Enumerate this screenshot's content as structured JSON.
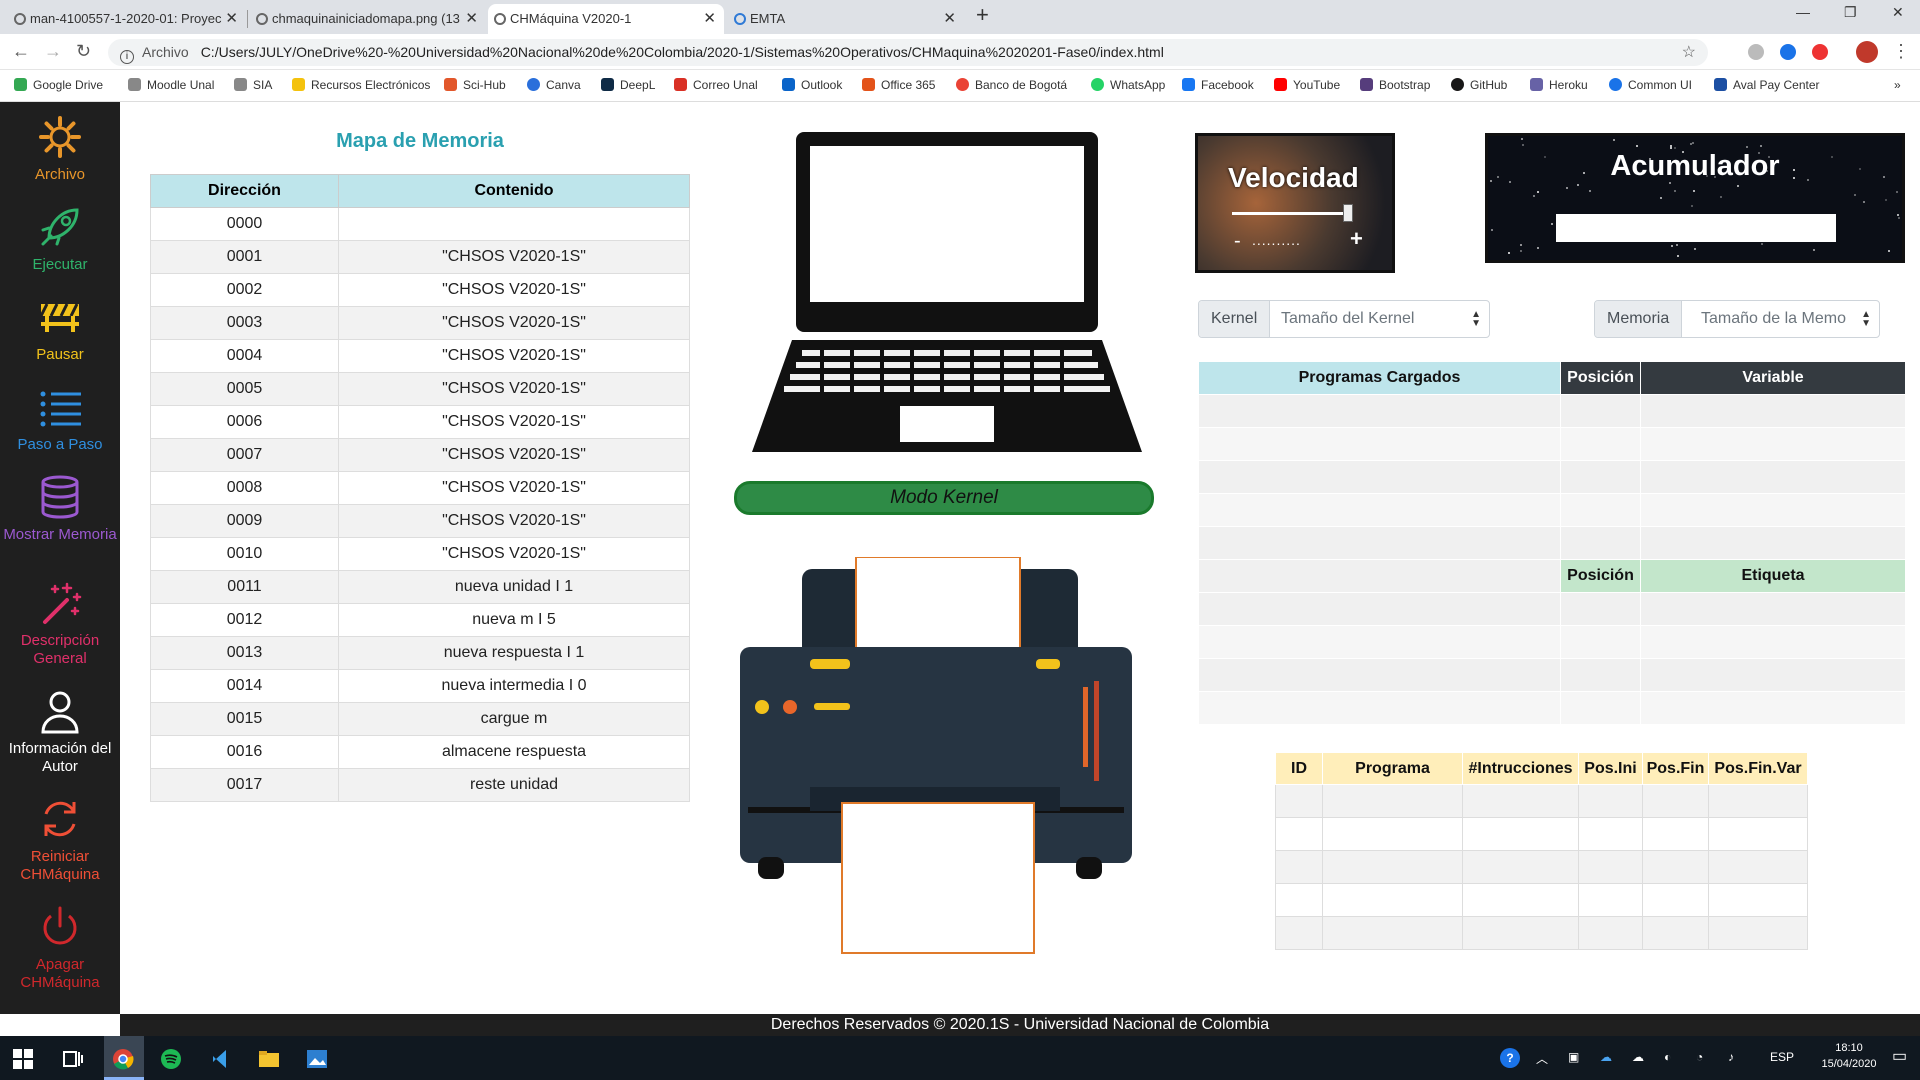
{
  "browser": {
    "tabs": [
      {
        "title": "man-4100557-1-2020-01: Proyec"
      },
      {
        "title": "chmaquinainiciadomapa.png (13"
      },
      {
        "title": "CHMáquina V2020-1"
      },
      {
        "title": "EMTA"
      }
    ],
    "address_label": "Archivo",
    "url": "C:/Users/JULY/OneDrive%20-%20Universidad%20Nacional%20de%20Colombia/2020-1/Sistemas%20Operativos/CHMaquina%2020201-Fase0/index.html",
    "bookmarks": [
      "Google Drive",
      "Moodle Unal",
      "SIA",
      "Recursos Electrónicos",
      "Sci-Hub",
      "Canva",
      "DeepL",
      "Correo Unal",
      "Outlook",
      "Office 365",
      "Banco de Bogotá",
      "WhatsApp",
      "Facebook",
      "YouTube",
      "Bootstrap",
      "GitHub",
      "Heroku",
      "Common UI",
      "Aval Pay Center"
    ]
  },
  "sidebar": {
    "items": [
      {
        "label": "Archivo",
        "color": "#e8962a"
      },
      {
        "label": "Ejecutar",
        "color": "#2fb36b"
      },
      {
        "label": "Pausar",
        "color": "#f2c21b"
      },
      {
        "label": "Paso a Paso",
        "color": "#2f8fe0"
      },
      {
        "label": "Mostrar Memoria",
        "color": "#9b59d0"
      },
      {
        "label": "Descripción General",
        "color": "#e0306a"
      },
      {
        "label": "Información del Autor",
        "color": "#ffffff"
      },
      {
        "label": "Reiniciar CHMáquina",
        "color": "#ef4f36"
      },
      {
        "label": "Apagar CHMáquina",
        "color": "#d0282c"
      }
    ]
  },
  "memory": {
    "title": "Mapa de Memoria",
    "headers": [
      "Dirección",
      "Contenido"
    ],
    "rows": [
      [
        "0000",
        ""
      ],
      [
        "0001",
        "\"CHSOS V2020-1S\""
      ],
      [
        "0002",
        "\"CHSOS V2020-1S\""
      ],
      [
        "0003",
        "\"CHSOS V2020-1S\""
      ],
      [
        "0004",
        "\"CHSOS V2020-1S\""
      ],
      [
        "0005",
        "\"CHSOS V2020-1S\""
      ],
      [
        "0006",
        "\"CHSOS V2020-1S\""
      ],
      [
        "0007",
        "\"CHSOS V2020-1S\""
      ],
      [
        "0008",
        "\"CHSOS V2020-1S\""
      ],
      [
        "0009",
        "\"CHSOS V2020-1S\""
      ],
      [
        "0010",
        "\"CHSOS V2020-1S\""
      ],
      [
        "0011",
        "nueva unidad I 1"
      ],
      [
        "0012",
        "nueva m I 5"
      ],
      [
        "0013",
        "nueva respuesta I 1"
      ],
      [
        "0014",
        "nueva intermedia I 0"
      ],
      [
        "0015",
        "cargue m"
      ],
      [
        "0016",
        "almacene respuesta"
      ],
      [
        "0017",
        "reste unidad"
      ]
    ]
  },
  "modo": "Modo Kernel",
  "velocidad": {
    "title": "Velocidad",
    "minus": "-",
    "plus": "+",
    "dots": "..........",
    "level": 0.97
  },
  "acumulador": {
    "title": "Acumulador",
    "value": ""
  },
  "kernel": {
    "label": "Kernel",
    "placeholder": "Tamaño del Kernel"
  },
  "memoria": {
    "label": "Memoria",
    "placeholder": "Tamaño de la Memo"
  },
  "programs_table": {
    "headers": [
      "Programas Cargados",
      "Posición",
      "Variable"
    ],
    "headers2": [
      "Posición",
      "Etiqueta"
    ]
  },
  "process_table": {
    "headers": [
      "ID",
      "Programa",
      "#Intrucciones",
      "Pos.Ini",
      "Pos.Fin",
      "Pos.Fin.Var"
    ]
  },
  "footer": "Derechos Reservados © 2020.1S - Universidad Nacional de Colombia",
  "taskbar": {
    "lang": "ESP",
    "time": "18:10",
    "date": "15/04/2020"
  }
}
